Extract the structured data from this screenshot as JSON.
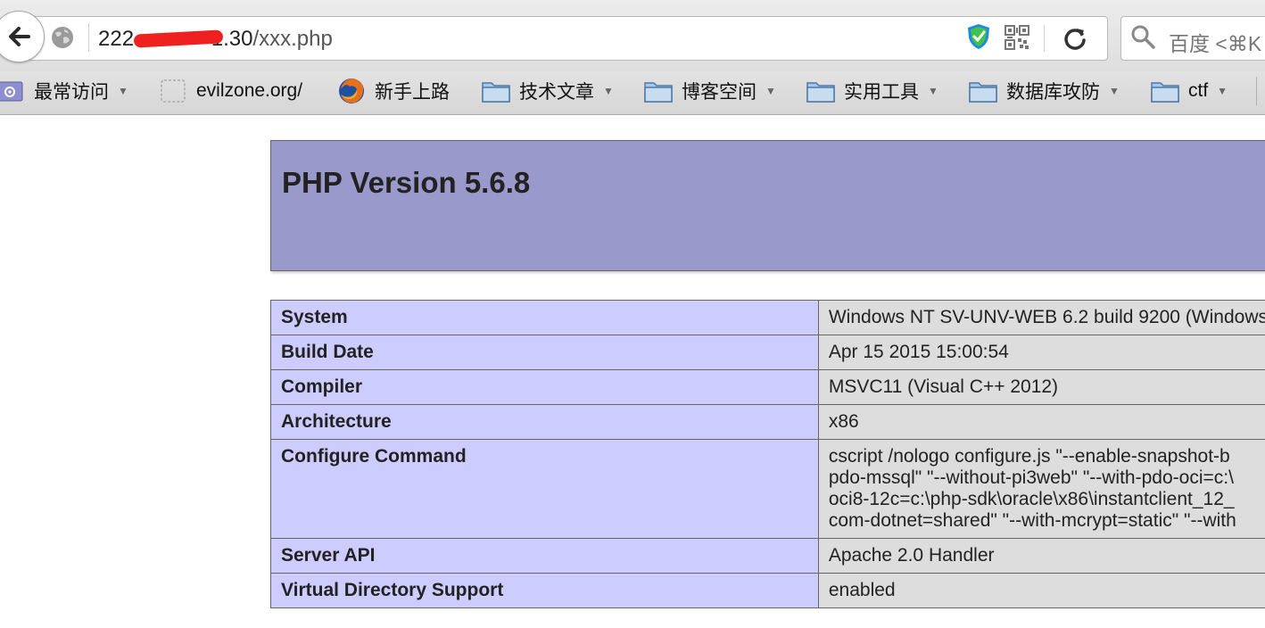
{
  "browser": {
    "url_host_prefix": "222.",
    "url_host_suffix": "1.30",
    "url_path": "/xxx.php",
    "search_placeholder": "百度 <⌘K"
  },
  "bookmarks": [
    {
      "label": "最常访问",
      "icon": "gear-folder-icon",
      "dropdown": true
    },
    {
      "label": "evilzone.org/",
      "icon": "blank-page-icon",
      "dropdown": false
    },
    {
      "label": "新手上路",
      "icon": "firefox-icon",
      "dropdown": false
    },
    {
      "label": "技术文章",
      "icon": "folder-icon",
      "dropdown": true
    },
    {
      "label": "博客空间",
      "icon": "folder-icon",
      "dropdown": true
    },
    {
      "label": "实用工具",
      "icon": "folder-icon",
      "dropdown": true
    },
    {
      "label": "数据库攻防",
      "icon": "folder-icon",
      "dropdown": true
    },
    {
      "label": "ctf",
      "icon": "folder-icon",
      "dropdown": true
    }
  ],
  "page": {
    "title": "PHP Version 5.6.8",
    "rows": [
      {
        "key": "System",
        "value": "Windows NT SV-UNV-WEB 6.2 build 9200 (Windows"
      },
      {
        "key": "Build Date",
        "value": "Apr 15 2015 15:00:54"
      },
      {
        "key": "Compiler",
        "value": "MSVC11 (Visual C++ 2012)"
      },
      {
        "key": "Architecture",
        "value": "x86"
      },
      {
        "key": "Configure Command",
        "lines": [
          "cscript /nologo configure.js \"--enable-snapshot-b",
          "pdo-mssql\" \"--without-pi3web\" \"--with-pdo-oci=c:\\",
          "oci8-12c=c:\\php-sdk\\oracle\\x86\\instantclient_12_",
          "com-dotnet=shared\" \"--with-mcrypt=static\" \"--with"
        ]
      },
      {
        "key": "Server API",
        "value": "Apache 2.0 Handler"
      },
      {
        "key": "Virtual Directory Support",
        "value": "enabled"
      }
    ]
  },
  "colors": {
    "header_bg": "#9999cc",
    "key_bg": "#ccccff",
    "value_bg": "#dddddd",
    "redaction": "#ee2020"
  }
}
